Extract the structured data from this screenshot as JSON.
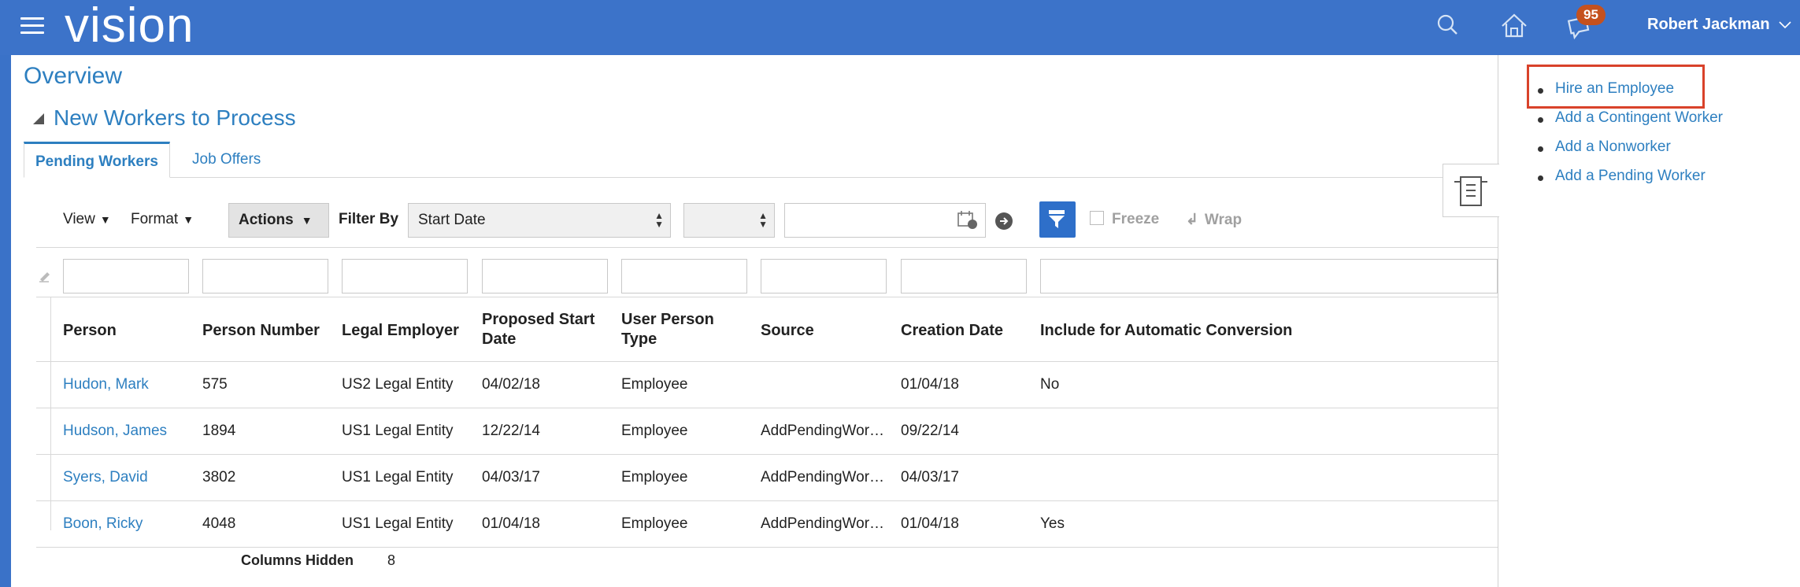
{
  "header": {
    "logo": "vision",
    "notification_count": "95",
    "user_name": "Robert Jackman",
    "icons": [
      "hamburger-icon",
      "search-icon",
      "home-icon",
      "notifications-icon",
      "chevron-down-icon"
    ]
  },
  "main": {
    "page_title": "Overview",
    "section_title": "New Workers to Process",
    "tabs": [
      {
        "label": "Pending Workers"
      },
      {
        "label": "Job Offers"
      }
    ],
    "toolbar": {
      "view_label": "View",
      "format_label": "Format",
      "actions_label": "Actions",
      "filter_by_label": "Filter By",
      "filter_field_value": "Start Date",
      "operator_value": "",
      "freeze_label": "Freeze",
      "wrap_label": "Wrap"
    },
    "table": {
      "columns": [
        "Person",
        "Person Number",
        "Legal Employer",
        "Proposed Start Date",
        "User Person Type",
        "Source",
        "Creation Date",
        "Include for Automatic Conversion"
      ],
      "rows": [
        {
          "person": "Hudon, Mark",
          "number": "575",
          "employer": "US2 Legal Entity",
          "start": "04/02/18",
          "type": "Employee",
          "source": "",
          "created": "01/04/18",
          "include": "No"
        },
        {
          "person": "Hudson, James",
          "number": "1894",
          "employer": "US1 Legal Entity",
          "start": "12/22/14",
          "type": "Employee",
          "source": "AddPendingWor…",
          "created": "09/22/14",
          "include": ""
        },
        {
          "person": "Syers, David",
          "number": "3802",
          "employer": "US1 Legal Entity",
          "start": "04/03/17",
          "type": "Employee",
          "source": "AddPendingWor…",
          "created": "04/03/17",
          "include": ""
        },
        {
          "person": "Boon, Ricky",
          "number": "4048",
          "employer": "US1 Legal Entity",
          "start": "01/04/18",
          "type": "Employee",
          "source": "AddPendingWor…",
          "created": "01/04/18",
          "include": "Yes"
        }
      ],
      "footer_label": "Columns Hidden",
      "footer_value": "8"
    }
  },
  "tasks": {
    "items": [
      {
        "label": "Hire an Employee"
      },
      {
        "label": "Add a Contingent Worker"
      },
      {
        "label": "Add a Nonworker"
      },
      {
        "label": "Add a Pending Worker"
      }
    ]
  },
  "colors": {
    "header_bg": "#3c73c9",
    "link": "#2d7fc0",
    "badge": "#c5511e",
    "highlight": "#d9422a"
  }
}
